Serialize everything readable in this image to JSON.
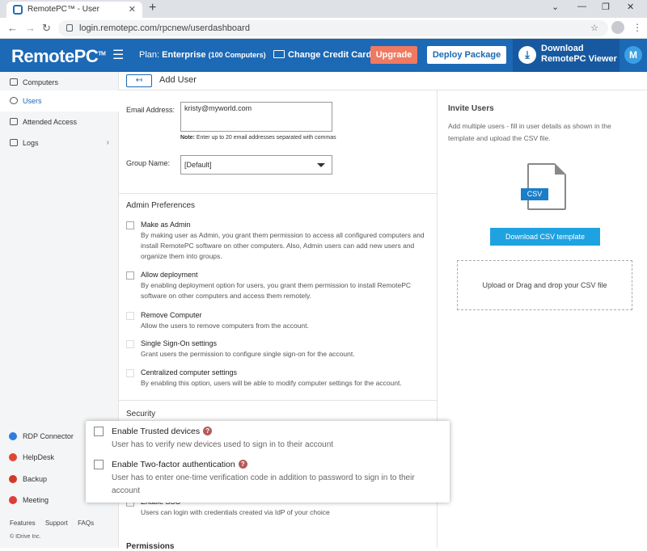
{
  "browser": {
    "tab_title": "RemotePC™ - User Management",
    "url": "login.remotepc.com/rpcnew/userdashboard"
  },
  "header": {
    "logo": "RemotePC",
    "logo_tm": "TM",
    "plan_label": "Plan:",
    "plan_name": "Enterprise",
    "plan_count": "(100 Computers)",
    "change_card": "Change Credit Card",
    "upgrade": "Upgrade",
    "deploy": "Deploy Package",
    "download_line1": "Download",
    "download_line2": "RemotePC Viewer",
    "avatar": "M"
  },
  "sidebar": {
    "items": [
      {
        "label": "Computers"
      },
      {
        "label": "Users"
      },
      {
        "label": "Attended Access"
      },
      {
        "label": "Logs"
      }
    ],
    "bottom": [
      {
        "label": "RDP Connector"
      },
      {
        "label": "HelpDesk"
      },
      {
        "label": "Backup"
      },
      {
        "label": "Meeting"
      }
    ],
    "links": [
      "Features",
      "Support",
      "FAQs"
    ],
    "copyright": "© IDrive Inc."
  },
  "page": {
    "title": "Add User",
    "email_label": "Email Address:",
    "email_value": "kristy@myworld.com",
    "note_bold": "Note:",
    "note_text": " Enter up to 20 email addresses separated with commas",
    "group_label": "Group Name:",
    "group_value": "[Default]",
    "admin_prefs_heading": "Admin Preferences",
    "prefs": [
      {
        "title": "Make as Admin",
        "desc": "By making user as Admin, you grant them permission to access all configured computers and install RemotePC software on other computers. Also, Admin users can add new users and organize them into groups."
      },
      {
        "title": "Allow deployment",
        "desc": "By enabling deployment option for users, you grant them permission to install RemotePC software on other computers and access them remotely."
      },
      {
        "title": "Remove Computer",
        "desc": "Allow the users to remove computers from the account."
      },
      {
        "title": "Single Sign-On settings",
        "desc": "Grant users the permission to configure single sign-on for the account."
      },
      {
        "title": "Centralized computer settings",
        "desc": "By enabling this option, users will be able to modify computer settings for the account."
      }
    ],
    "security_heading": "Security",
    "sso_title": "Enable SSO",
    "sso_desc": "Users can login with credentials created via IdP of your choice",
    "permissions_heading": "Permissions"
  },
  "invite": {
    "heading": "Invite Users",
    "desc": "Add multiple users - fill in user details as shown in the template and upload the CSV file.",
    "csv_tag": "CSV",
    "download_btn": "Download CSV template",
    "drop_text": "Upload or Drag and drop your CSV file"
  },
  "popup": {
    "items": [
      {
        "title": "Enable Trusted devices",
        "desc": "User has to verify new devices used to sign in to their account"
      },
      {
        "title": "Enable Two-factor authentication",
        "desc": "User has to enter one-time verification code in addition to password to sign in to their account"
      }
    ],
    "help": "?"
  }
}
